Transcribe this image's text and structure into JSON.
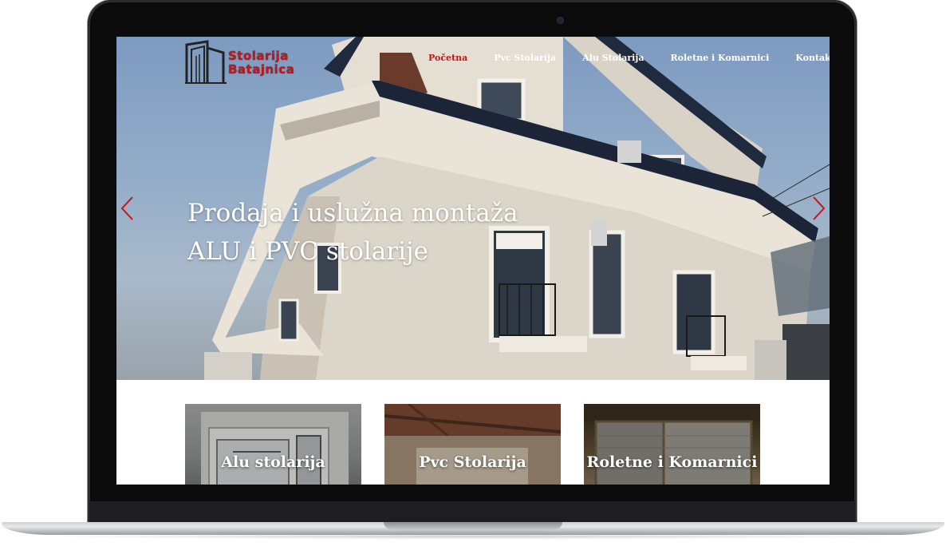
{
  "logo": {
    "line1": "Stolarija",
    "line2": "Batajnica"
  },
  "nav": {
    "items": [
      {
        "label": "Početna",
        "active": true
      },
      {
        "label": "Pvc Stolarija",
        "active": false
      },
      {
        "label": "Alu Stolarija",
        "active": false
      },
      {
        "label": "Roletne i Komarnici",
        "active": false
      },
      {
        "label": "Kontakt",
        "active": false
      }
    ]
  },
  "hero": {
    "line1": "Prodaja i uslužna montaža",
    "line2": "ALU i PVC stolarije",
    "prev_icon": "chevron-left-icon",
    "next_icon": "chevron-right-icon"
  },
  "cards": [
    {
      "label": "Alu stolarija"
    },
    {
      "label": "Pvc Stolarija"
    },
    {
      "label": "Roletne i Komarnici"
    }
  ],
  "colors": {
    "accent": "#c4161c",
    "nav_text": "#ffffff"
  }
}
